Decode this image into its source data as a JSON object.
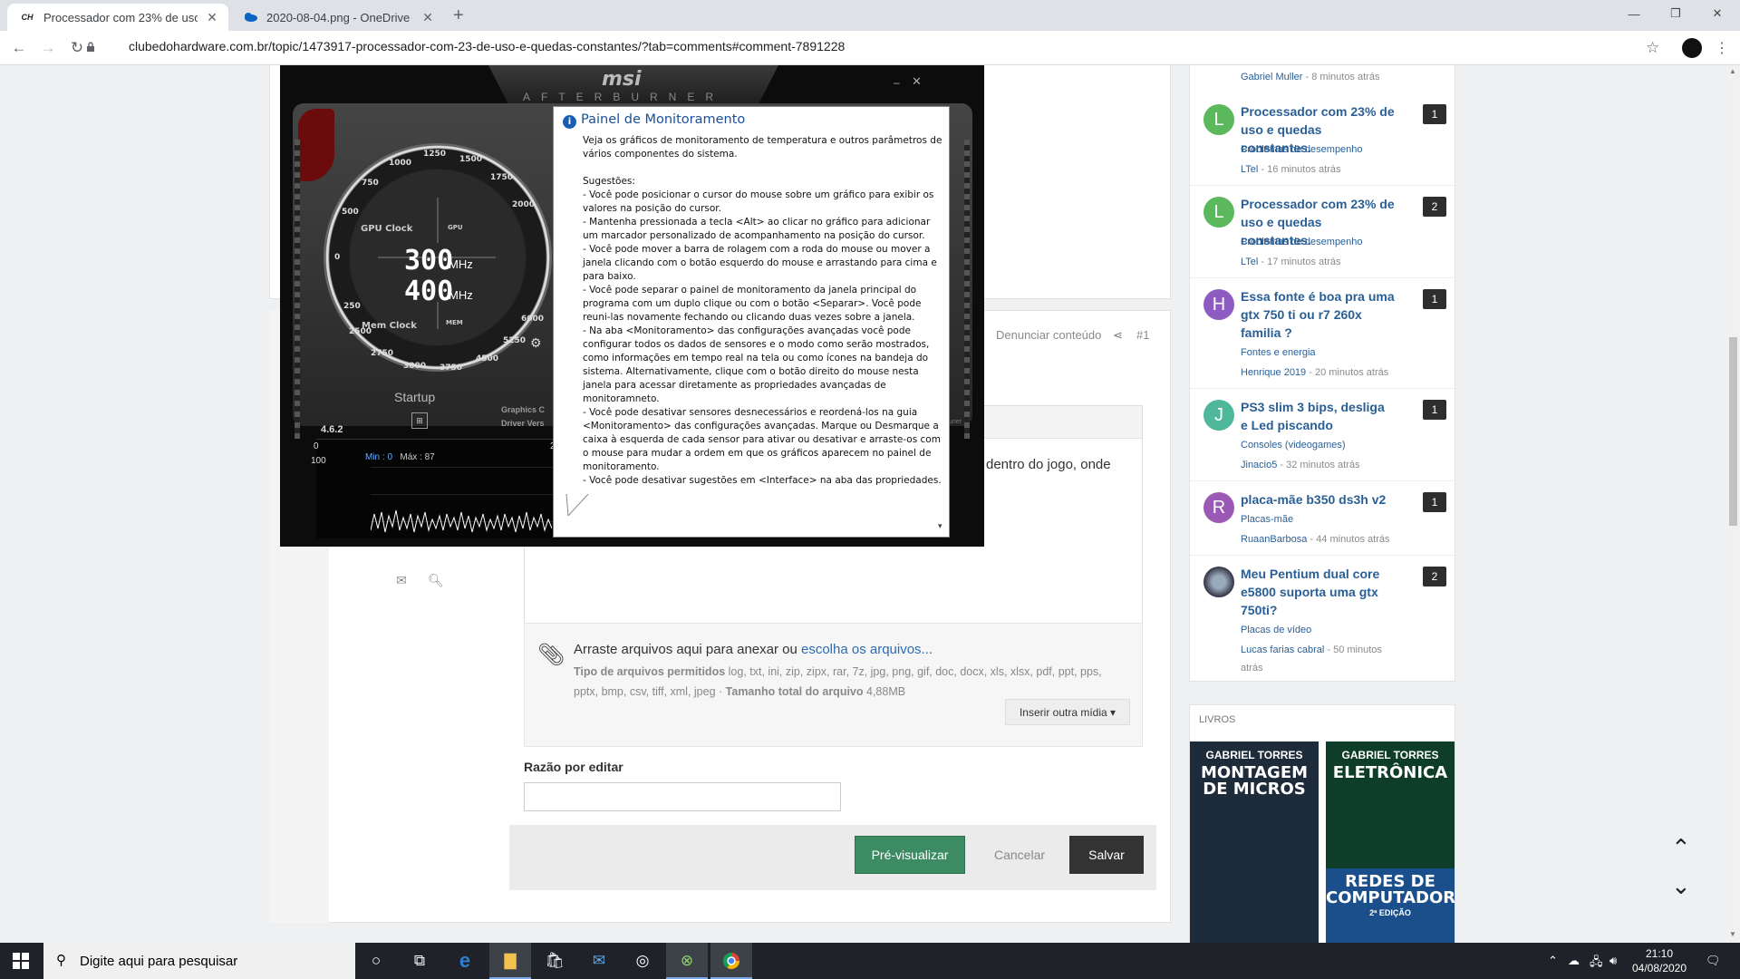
{
  "browser": {
    "tabs": [
      {
        "label": "Processador com 23% de uso e q",
        "favicon": "CH"
      },
      {
        "label": "2020-08-04.png - OneDrive",
        "favicon": "onedrive-icon"
      }
    ],
    "new_tab": "+",
    "url": "clubedohardware.com.br/topic/1473917-processador-com-23-de-uso-e-quedas-constantes/?tab=comments#comment-7891228"
  },
  "post": {
    "report": "Denunciar conteúdo",
    "post_number": "#1",
    "editor_text": "dentro do jogo, onde"
  },
  "attach": {
    "drop_text": "Arraste arquivos aqui para anexar ou ",
    "choose_link": "escolha os arquivos...",
    "types_label": "Tipo de arquivos permitidos",
    "types": "log, txt, ini, zip, zipx, rar, 7z, jpg, png, gif, doc, docx, xls, xlsx, pdf, ppt, pps, pptx, bmp, csv, tiff, xml, jpeg",
    "size_label": "Tamanho total do arquivo",
    "size": "4,88MB",
    "media_button": "Inserir outra mídia ▾"
  },
  "form": {
    "reason_label": "Razão por editar",
    "preview": "Pré-visualizar",
    "cancel": "Cancelar",
    "save": "Salvar"
  },
  "sidebar": {
    "top_meta": {
      "author": "Gabriel Muller",
      "time": " - 8 minutos atrás"
    },
    "items": [
      {
        "avatar": "L",
        "color": "#5cb85c",
        "title": "Processador com 23% de uso e quedas constantes.",
        "category": "Problemas de desempenho",
        "author": "LTel",
        "time": " - 16 minutos atrás",
        "count": "1"
      },
      {
        "avatar": "L",
        "color": "#5cb85c",
        "title": "Processador com 23% de uso e quedas constantes.",
        "category": "Problemas de desempenho",
        "author": "LTel",
        "time": " - 17 minutos atrás",
        "count": "2"
      },
      {
        "avatar": "H",
        "color": "#8e5bc2",
        "title": "Essa fonte é boa pra uma gtx 750 ti ou r7 260x familia ?",
        "category": "Fontes e energia",
        "author": "Henrique 2019",
        "time": " - 20 minutos atrás",
        "count": "1"
      },
      {
        "avatar": "J",
        "color": "#4fb89a",
        "title": "PS3 slim 3 bips, desliga e Led piscando",
        "category": "Consoles (videogames)",
        "author": "Jinacio5",
        "time": " - 32 minutos atrás",
        "count": "1"
      },
      {
        "avatar": "R",
        "color": "#9b59b6",
        "title": "placa-mãe b350 ds3h v2",
        "category": "Placas-mãe",
        "author": "RuaanBarbosa",
        "time": " - 44 minutos atrás",
        "count": "1"
      },
      {
        "avatar": "",
        "color": "#555555",
        "title": "Meu Pentium dual core e5800 suporta uma gtx 750ti?",
        "category": "Placas de vídeo",
        "author": "Lucas farias cabral",
        "time": " - 50 minutos atrás",
        "count": "2"
      }
    ],
    "books_header": "LIVROS",
    "books": [
      {
        "author": "GABRIEL TORRES",
        "title": "MONTAGEM DE MICROS",
        "color": "#1d2b3a"
      },
      {
        "author": "GABRIEL TORRES",
        "title": "ELETRÔNICA",
        "color": "#0e3d2a"
      }
    ],
    "book3_title": "REDES DE COMPUTADORES",
    "book3_edition": "2ª EDIÇÃO"
  },
  "afterburner": {
    "brand": "msi",
    "subbrand": "AFTERBURNER",
    "gpu_clock_label": "GPU Clock",
    "mem_clock_label": "Mem Clock",
    "gpu_chip": "GPU",
    "mem_chip": "MEM",
    "gpu_value": "300",
    "mem_value": "400",
    "unit": "MHz",
    "ticks": [
      "250",
      "500",
      "750",
      "1000",
      "1250",
      "1500",
      "1750",
      "2000",
      "2250",
      "2500",
      "2750",
      "3000",
      "3750",
      "4500",
      "5250",
      "6000",
      "0"
    ],
    "startup": "Startup",
    "graphics_card": "Graphics C",
    "driver_version": "Driver Vers",
    "version": "4.6.2",
    "graph_min_label": "Min : 0",
    "graph_max_label": "Máx : 87",
    "axis_top": "0",
    "axis_bottom": "100",
    "graph_value": "21",
    "tuner": "tuner"
  },
  "tooltip": {
    "title": "Painel de Monitoramento",
    "body": "Veja os gráficos de monitoramento de temperatura e outros parâmetros de vários componentes do sistema.\n\nSugestões:\n- Você pode posicionar o cursor do mouse sobre um gráfico para exibir os valores na posição do cursor.\n- Mantenha pressionada a tecla <Alt> ao clicar no gráfico para adicionar um marcador personalizado de acompanhamento na posição do cursor.\n- Você pode mover a barra de rolagem com a roda do mouse ou mover a janela clicando com o botão esquerdo do mouse e arrastando para cima e para baixo.\n- Você pode separar o painel de monitoramento da janela principal do programa com um duplo clique ou com o botão <Separar>. Você pode reuni-las novamente fechando ou clicando duas vezes sobre a janela.\n- Na aba <Monitoramento> das configurações avançadas você pode configurar todos os dados de sensores e o modo como serão mostrados, como informações em tempo real na tela ou como ícones na bandeja do sistema. Alternativamente, clique com o botão direito do mouse nesta janela para acessar diretamente as propriedades avançadas de monitoramneto.\n- Você pode desativar sensores desnecessários e reordená-los na guia <Monitoramento> das configurações avançadas. Marque ou Desmarque a caixa à esquerda de cada sensor para ativar ou desativar e arraste-os com o mouse para mudar a ordem em que os gráficos aparecem no painel de monitoramento.\n- Você pode desativar sugestões em <Interface> na aba das propriedades."
  },
  "taskbar": {
    "search_placeholder": "Digite aqui para pesquisar",
    "time": "21:10",
    "date": "04/08/2020"
  }
}
